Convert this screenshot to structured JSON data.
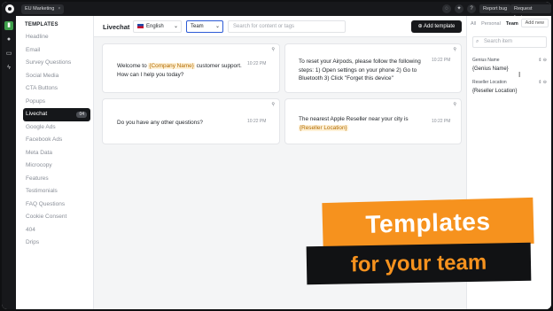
{
  "topbar": {
    "workspace": "EU Marketing",
    "workspace_close": "×",
    "icons": [
      "chat-icon",
      "sparkle-icon",
      "help-icon"
    ],
    "report_bug": "Report bug",
    "request_feature": "Request feature"
  },
  "rail": {
    "items": [
      "templates-icon",
      "person-icon",
      "document-icon",
      "bolt-icon"
    ]
  },
  "sidebar": {
    "heading": "TEMPLATES",
    "items": [
      {
        "label": "Headline"
      },
      {
        "label": "Email"
      },
      {
        "label": "Survey Questions"
      },
      {
        "label": "Social Media"
      },
      {
        "label": "CTA Buttons"
      },
      {
        "label": "Popups"
      },
      {
        "label": "Livechat",
        "badge": "04",
        "active": true
      },
      {
        "label": "Google Ads"
      },
      {
        "label": "Facebook Ads"
      },
      {
        "label": "Meta Data"
      },
      {
        "label": "Microcopy"
      },
      {
        "label": "Features"
      },
      {
        "label": "Testimonials"
      },
      {
        "label": "FAQ Questions"
      },
      {
        "label": "Cookie Consent"
      },
      {
        "label": "404"
      },
      {
        "label": "Drips"
      }
    ]
  },
  "main": {
    "title": "Livechat",
    "language": "English",
    "scope": "Team",
    "search_placeholder": "Search for content or tags",
    "add_template": "Add template",
    "cards": [
      {
        "time": "10:22 PM",
        "parts": [
          "Welcome to ",
          "{Company Name}",
          " customer support. How can I help you today?"
        ]
      },
      {
        "time": "10:22 PM",
        "parts": [
          "To reset your Airpods, please follow the following steps: 1) Open settings on your phone 2) Go to Bluetooth 3) Click \"Forget this device\""
        ]
      },
      {
        "time": "10:22 PM",
        "parts": [
          "Do you have any other questions?"
        ]
      },
      {
        "time": "10:22 PM",
        "parts": [
          "The nearest Apple Reseller near your city is ",
          "{Reseller Location}"
        ]
      }
    ]
  },
  "right_panel": {
    "tabs": [
      "All",
      "Personal",
      "Team"
    ],
    "active_tab": "Team",
    "add_new": "Add new",
    "search_placeholder": "Search item",
    "variables": [
      {
        "label": "Genius Name",
        "value": "{Genius Name}"
      },
      {
        "label": "Reseller Location",
        "value": "{Reseller Location}"
      }
    ]
  },
  "promo": {
    "line1": "Templates",
    "line2": "for your team"
  },
  "colors": {
    "accent_orange": "#f6921e",
    "rail_active": "#3e9e4a",
    "dark": "#17181b"
  }
}
